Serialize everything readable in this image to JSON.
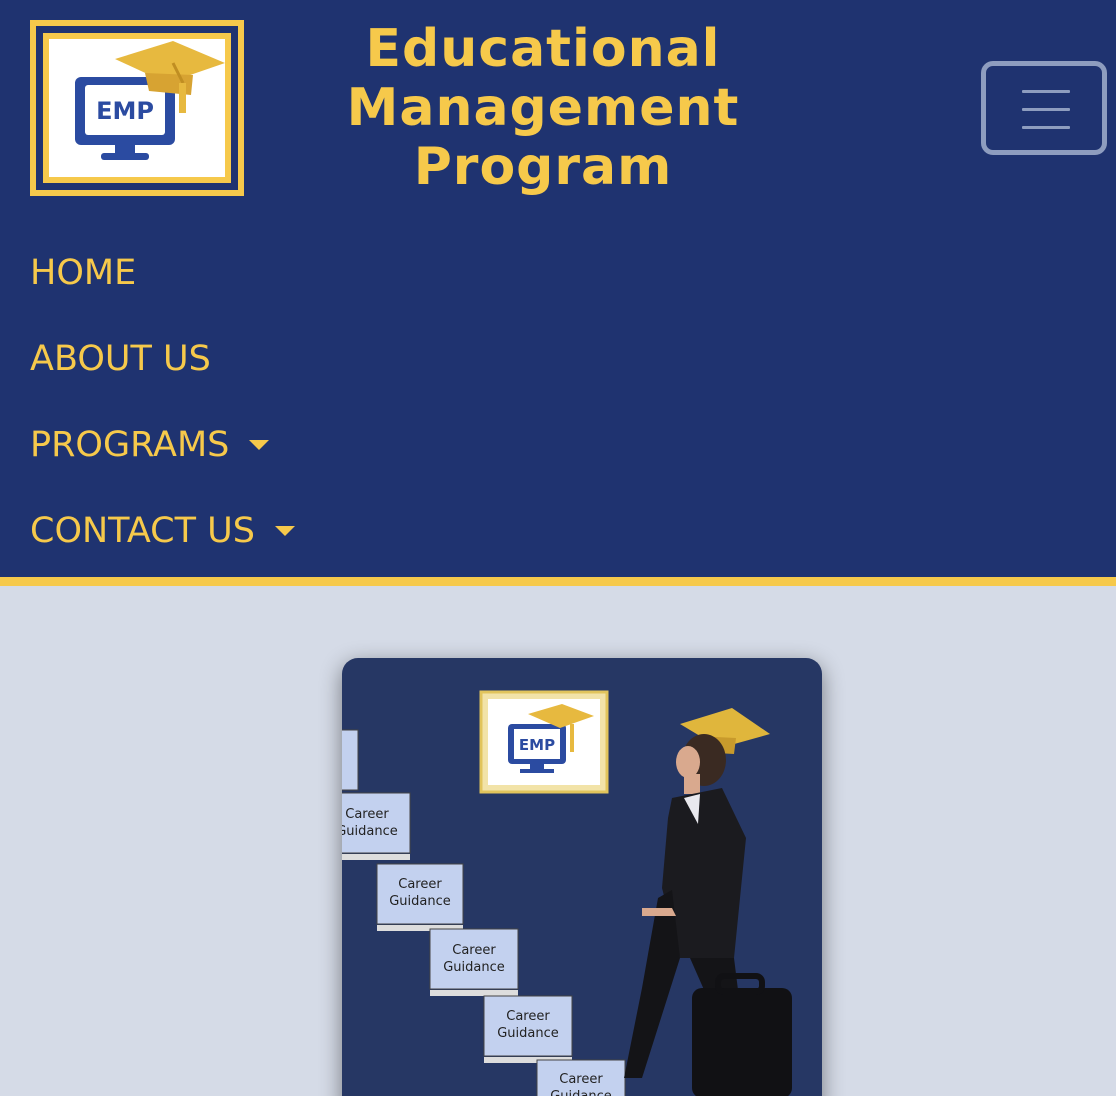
{
  "header": {
    "logo_text": "EMP",
    "title_lines": [
      "Educational",
      "Management",
      "Program"
    ]
  },
  "nav": {
    "home": "HOME",
    "about": "ABOUT US",
    "programs": "PROGRAMS",
    "contact": "CONTACT US"
  },
  "hero": {
    "logo_text": "EMP",
    "step_label_line1": "Career",
    "step_label_line2": "Guidance"
  },
  "colors": {
    "navy": "#1f3370",
    "gold": "#f6c94b",
    "page_bg": "#d5dbe7"
  },
  "icons": [
    "hamburger-menu-icon",
    "caret-down-icon",
    "graduation-cap-icon",
    "monitor-icon"
  ]
}
